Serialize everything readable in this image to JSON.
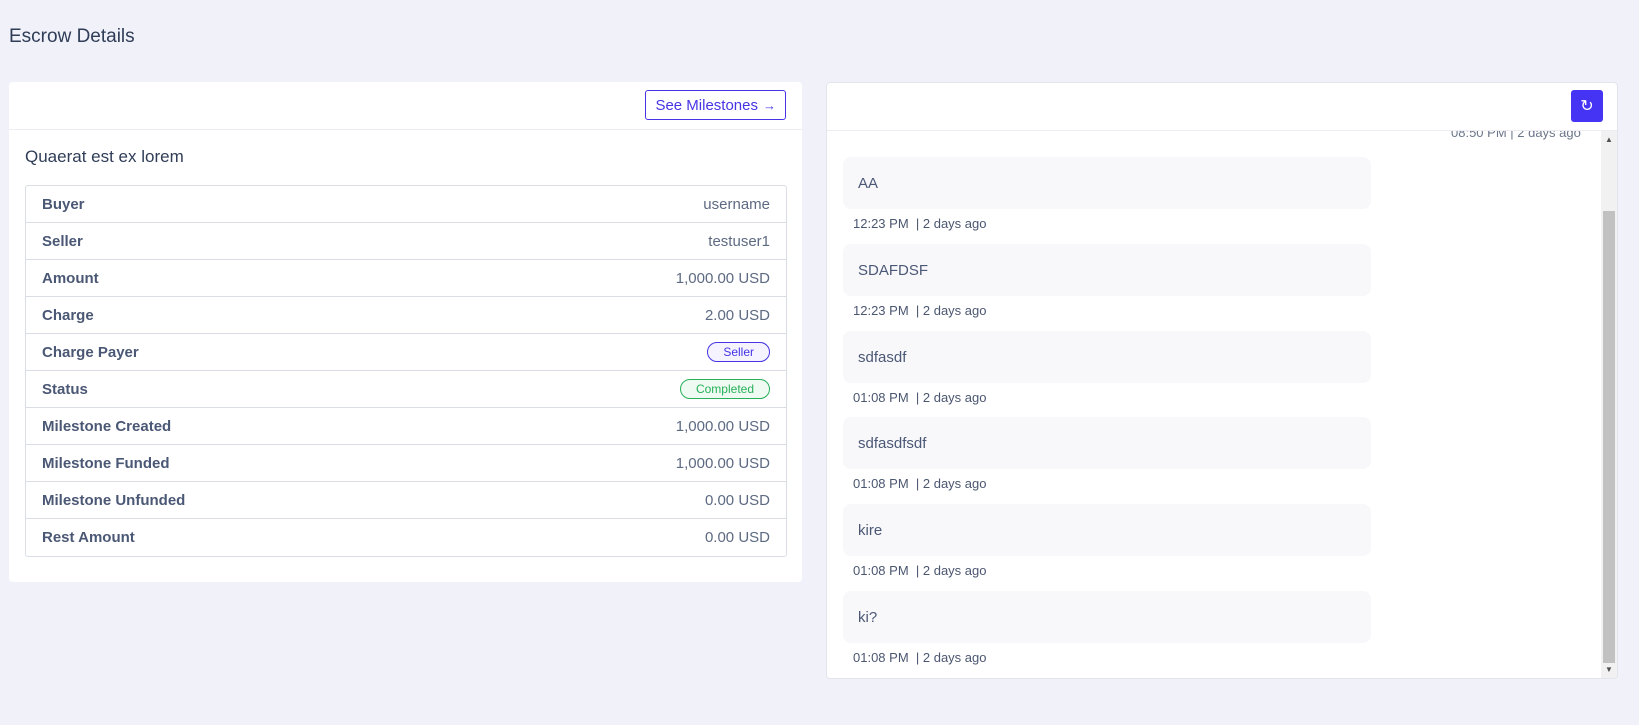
{
  "page": {
    "title": "Escrow Details"
  },
  "escrow": {
    "milestones_button": "See Milestones",
    "milestones_arrow": "→",
    "title": "Quaerat est ex lorem",
    "rows": [
      {
        "label": "Buyer",
        "value": "username"
      },
      {
        "label": "Seller",
        "value": "testuser1"
      },
      {
        "label": "Amount",
        "value": "1,000.00 USD"
      },
      {
        "label": "Charge",
        "value": "2.00 USD"
      },
      {
        "label": "Charge Payer",
        "value": "Seller"
      },
      {
        "label": "Status",
        "value": "Completed"
      },
      {
        "label": "Milestone Created",
        "value": "1,000.00 USD"
      },
      {
        "label": "Milestone Funded",
        "value": "1,000.00 USD"
      },
      {
        "label": "Milestone Unfunded",
        "value": "0.00 USD"
      },
      {
        "label": "Rest Amount",
        "value": "0.00 USD"
      }
    ]
  },
  "chat": {
    "refresh_icon": "↻",
    "partial_meta": "08:50 PM  |  2 days ago",
    "messages": [
      {
        "text": "AA",
        "time": "12:23 PM",
        "ago": "2 days ago"
      },
      {
        "text": "SDAFDSF",
        "time": "12:23 PM",
        "ago": "2 days ago"
      },
      {
        "text": "sdfasdf",
        "time": "01:08 PM",
        "ago": "2 days ago"
      },
      {
        "text": "sdfasdfsdf",
        "time": "01:08 PM",
        "ago": "2 days ago"
      },
      {
        "text": "kire",
        "time": "01:08 PM",
        "ago": "2 days ago"
      },
      {
        "text": "ki?",
        "time": "01:08 PM",
        "ago": "2 days ago"
      }
    ]
  },
  "scrollbar": {
    "up_arrow": "▲",
    "down_arrow": "▼"
  },
  "colors": {
    "accent": "#4634e4",
    "success": "#28b15a",
    "background": "#f1f1f9"
  }
}
